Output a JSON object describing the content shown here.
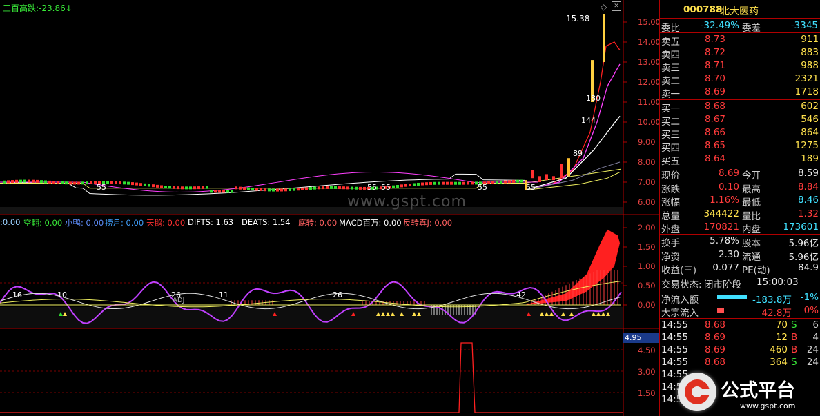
{
  "chart": {
    "title": "三百高跌:",
    "title_value": "-23.86",
    "watermark": "www.gspt.com",
    "peak_label": "15.38",
    "price_labels": [
      "180",
      "144",
      "89",
      "55",
      "55",
      "55",
      "55",
      "55"
    ],
    "price_axis": [
      "15.00",
      "14.00",
      "13.00",
      "12.00",
      "11.00",
      "10.00",
      "9.00",
      "8.00",
      "7.00",
      "6.00"
    ],
    "indicator_labels": [
      {
        "text": ":0.00",
        "color": "#9ad0ff"
      },
      {
        "text": "空翻: 0.00",
        "color": "#38e838"
      },
      {
        "text": "小鸭: 0.00",
        "color": "#6090ff"
      },
      {
        "text": "捞月: 0.00",
        "color": "#40a0ff"
      },
      {
        "text": "天鹅: 0.00",
        "color": "#ff3030"
      },
      {
        "text": "DIFTS: 1.63",
        "color": "#ffffff"
      },
      {
        "text": "DEATS: 1.54",
        "color": "#ffffff"
      },
      {
        "text": "底转: 0.00",
        "color": "#ff6060"
      },
      {
        "text": "MACD百万: 0.00",
        "color": "#ffffff"
      },
      {
        "text": "反转真J: 0.00",
        "color": "#ff6060"
      }
    ],
    "mid_axis": [
      "2.00",
      "1.50",
      "1.00",
      "0.50",
      "0.00"
    ],
    "mid_numbers": [
      "16",
      "10",
      "26",
      "11",
      "26",
      "42"
    ],
    "mid_tag": "ADJ",
    "bottom_axis": [
      "4.95",
      "4.50",
      "3.00",
      "1.50"
    ]
  },
  "quote": {
    "code": "000788",
    "name": "北大医药",
    "weibi_label": "委比",
    "weibi_value": "-32.49%",
    "weicha_label": "委差",
    "weicha_value": "-3345",
    "sells": [
      {
        "label": "卖五",
        "price": "8.73",
        "vol": "911"
      },
      {
        "label": "卖四",
        "price": "8.72",
        "vol": "883"
      },
      {
        "label": "卖三",
        "price": "8.71",
        "vol": "988"
      },
      {
        "label": "卖二",
        "price": "8.70",
        "vol": "2321"
      },
      {
        "label": "卖一",
        "price": "8.69",
        "vol": "1718"
      }
    ],
    "buys": [
      {
        "label": "买一",
        "price": "8.68",
        "vol": "602"
      },
      {
        "label": "买二",
        "price": "8.67",
        "vol": "546"
      },
      {
        "label": "买三",
        "price": "8.66",
        "vol": "864"
      },
      {
        "label": "买四",
        "price": "8.65",
        "vol": "1275"
      },
      {
        "label": "买五",
        "price": "8.64",
        "vol": "189"
      }
    ],
    "stats": [
      {
        "l1": "现价",
        "v1": "8.69",
        "c1": "red",
        "l2": "今开",
        "v2": "8.59",
        "c2": "white"
      },
      {
        "l1": "涨跌",
        "v1": "0.10",
        "c1": "red",
        "l2": "最高",
        "v2": "8.84",
        "c2": "red"
      },
      {
        "l1": "涨幅",
        "v1": "1.16%",
        "c1": "red",
        "l2": "最低",
        "v2": "8.46",
        "c2": "cyan"
      },
      {
        "l1": "总量",
        "v1": "344422",
        "c1": "yellow",
        "l2": "量比",
        "v2": "1.32",
        "c2": "red"
      },
      {
        "l1": "外盘",
        "v1": "170821",
        "c1": "red",
        "l2": "内盘",
        "v2": "173601",
        "c2": "cyan"
      }
    ],
    "stats2": [
      {
        "l1": "换手",
        "v1": "5.78%",
        "l2": "股本",
        "v2": "5.96亿"
      },
      {
        "l1": "净资",
        "v1": "2.30",
        "l2": "流通",
        "v2": "5.96亿"
      },
      {
        "l1": "收益(三)",
        "v1": "0.077",
        "l2": "PE(动)",
        "v2": "84.9"
      }
    ],
    "trade_status_label": "交易状态:",
    "trade_status": "闭市阶段",
    "trade_time": "15:00:03",
    "netflow_label": "净流入额",
    "netflow_value": "-183.8万",
    "netflow_pct": "-1%",
    "bigflow_label": "大宗流入",
    "bigflow_value": "42.8万",
    "bigflow_pct": "0%",
    "ticks": [
      {
        "time": "14:55",
        "price": "8.68",
        "vol": "70",
        "side": "S",
        "n": "6"
      },
      {
        "time": "14:55",
        "price": "8.69",
        "vol": "12",
        "side": "B",
        "n": "4"
      },
      {
        "time": "14:55",
        "price": "8.69",
        "vol": "460",
        "side": "B",
        "n": "24"
      },
      {
        "time": "14:55",
        "price": "8.68",
        "vol": "364",
        "side": "S",
        "n": "24"
      },
      {
        "time": "14:55",
        "price": "",
        "vol": "",
        "side": "",
        "n": ""
      },
      {
        "time": "14:5",
        "price": "",
        "vol": "",
        "side": "",
        "n": ""
      },
      {
        "time": "14:5",
        "price": "",
        "vol": "",
        "side": "",
        "n": ""
      }
    ],
    "logo_text": "公式平台",
    "logo_url": "www.gspt.com"
  }
}
